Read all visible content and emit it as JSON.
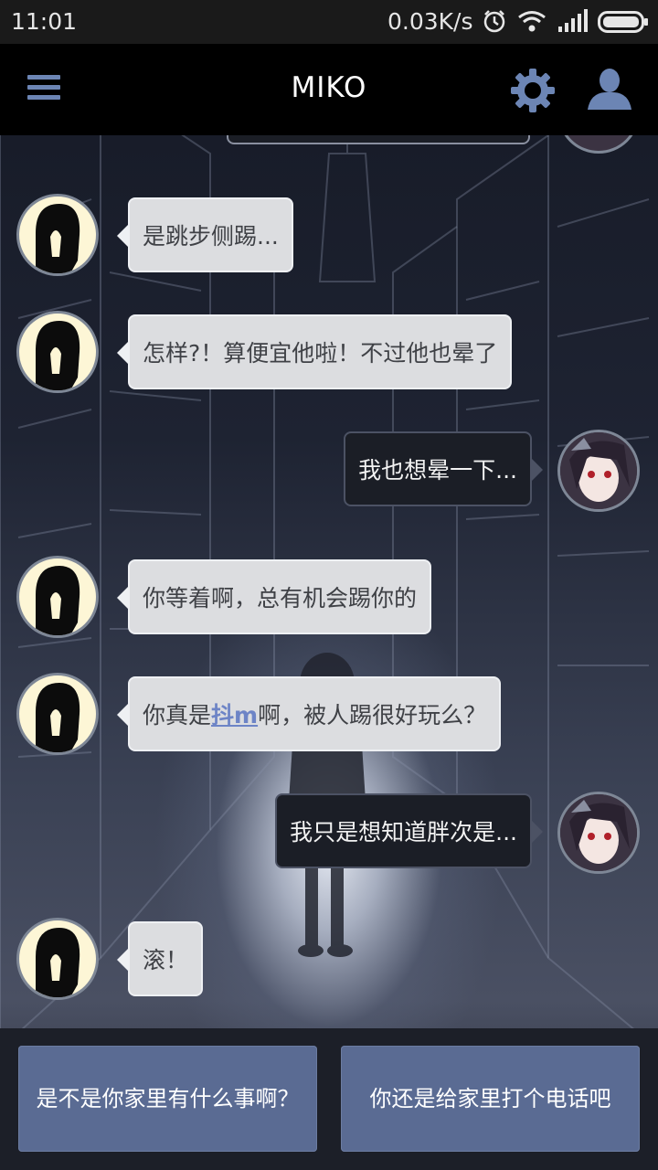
{
  "status_bar": {
    "time": "11:01",
    "net_speed": "0.03K/s",
    "icons": [
      "alarm-icon",
      "wifi-icon",
      "signal-icon",
      "battery-icon"
    ]
  },
  "header": {
    "title": "MIKO",
    "icons": [
      "menu-icon",
      "settings-icon",
      "profile-icon"
    ],
    "accent_color": "#6c85b4"
  },
  "messages": [
    {
      "side": "in",
      "text": "是跳步侧踢..."
    },
    {
      "side": "in",
      "text": "怎样?！算便宜他啦！不过他也晕了"
    },
    {
      "side": "out",
      "text": "我也想晕一下..."
    },
    {
      "side": "in",
      "text": "你等着啊，总有机会踢你的"
    },
    {
      "side": "in",
      "parts": {
        "before": "你真是",
        "highlight": "抖m",
        "after": "啊，被人踢很好玩么？"
      }
    },
    {
      "side": "out",
      "text": "我只是想知道胖次是..."
    },
    {
      "side": "in",
      "text": "滚！"
    }
  ],
  "choices": [
    {
      "label": "是不是你家里有什么事啊？"
    },
    {
      "label": "你还是给家里打个电话吧"
    }
  ],
  "colors": {
    "incoming_bubble": "#dcdde0",
    "outgoing_bubble": "#1b1e26",
    "choice_button": "#5a6b93",
    "highlight_text": "#6d84c6"
  }
}
